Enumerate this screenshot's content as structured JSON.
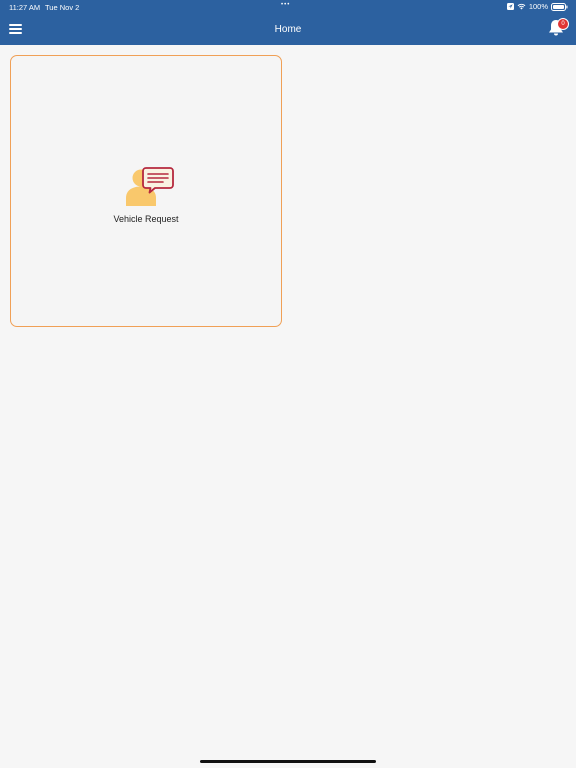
{
  "status_bar": {
    "time": "11:27 AM",
    "date": "Tue Nov 2",
    "dots": "•••",
    "battery": "100%"
  },
  "header": {
    "title": "Home",
    "notification_count": "0"
  },
  "tiles": [
    {
      "label": "Vehicle Request",
      "icon": "person-chat-icon"
    }
  ],
  "colors": {
    "header": "#2c61a0",
    "tile_border": "#f0a056",
    "badge": "#e03434",
    "icon_person": "#f9c86c",
    "icon_bubble": "#b5283e"
  }
}
